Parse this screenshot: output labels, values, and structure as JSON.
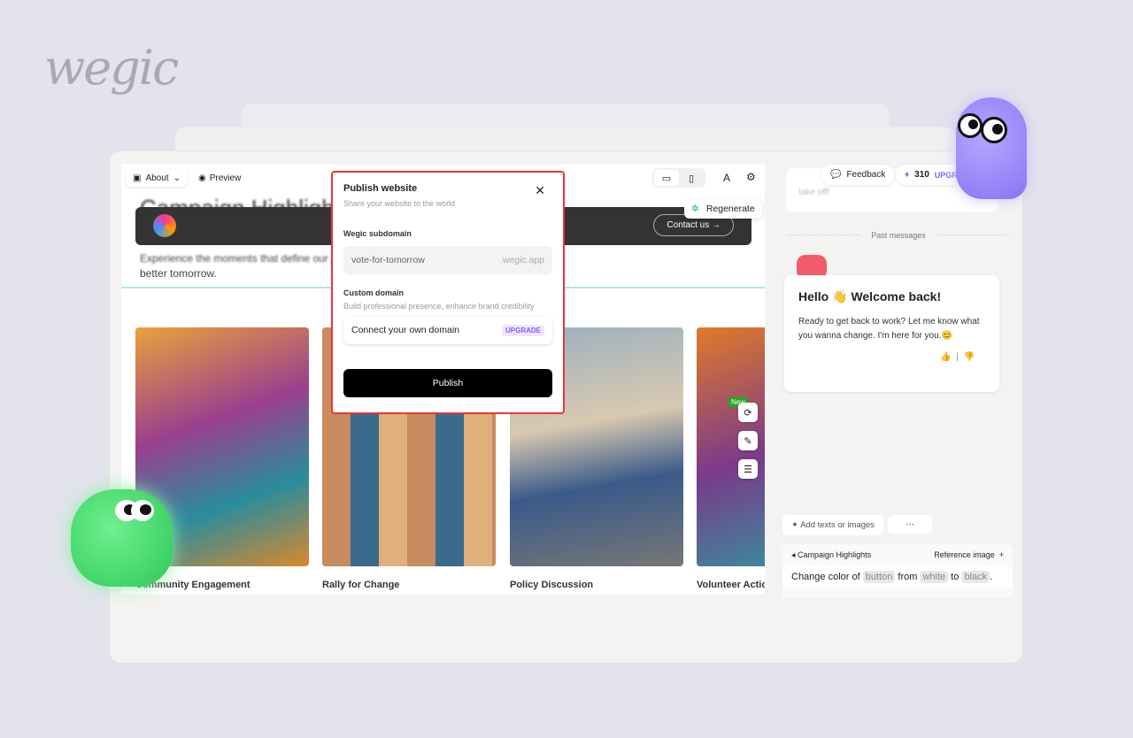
{
  "brand": {
    "logo": "wegic"
  },
  "toolbar": {
    "page_select": "About",
    "preview": "Preview",
    "icons": [
      "desktop-icon",
      "mobile-icon",
      "font-icon",
      "settings-icon"
    ]
  },
  "hero": {
    "title": "Campaign Highlights",
    "subtitle_line1": "Experience the moments that define our jo",
    "subtitle_line2": "better tomorrow.",
    "contact": "Contact us",
    "regenerate": "Regenerate"
  },
  "cards": [
    {
      "title": "Community Engagement"
    },
    {
      "title": "Rally for Change"
    },
    {
      "title": "Policy Discussion"
    },
    {
      "title": "Volunteer Action"
    }
  ],
  "side_tools": {
    "new_badge": "New"
  },
  "modal": {
    "title": "Publish website",
    "subtitle": "Share your website to the world",
    "subdomain_label": "Wegic subdomain",
    "subdomain_value": "vote-for-tomorrow",
    "subdomain_suffix": ".wegic.app",
    "custom_label": "Custom domain",
    "custom_desc": "Build professional presence, enhance brand credibility",
    "connect": "Connect your own domain",
    "upgrade": "UPGRADE",
    "publish": "Publish"
  },
  "chat": {
    "feedback": "Feedback",
    "credits": "310",
    "upgrade": "UPGRADE",
    "prev_text": "take off!",
    "past": "Past messages",
    "greeting": "Hello 👋 Welcome back!",
    "message": "Ready to get back to work? Let me know what you wanna change. I'm here for you.😊",
    "add": "Add texts or images",
    "more": "···",
    "context": "Campaign Highlights",
    "reference": "Reference image",
    "input": {
      "p1": "Change color of",
      "c1": "button",
      "p2": "from",
      "c2": "white",
      "p3": "to",
      "c3": "black",
      "end": "."
    }
  },
  "colors": {
    "accent": "#8a74f5",
    "highlight": "#e53935",
    "selection": "#a9f0d0"
  }
}
